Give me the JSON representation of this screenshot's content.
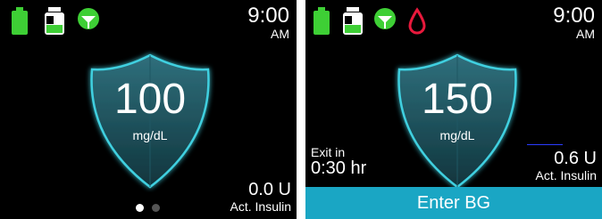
{
  "colors": {
    "battery": "#3ecf35",
    "insulin_cart": "#3ecf35",
    "signal": "#3ecf35",
    "drop_alert": "#e8193c",
    "shield_glow": "#3fd0e0",
    "button": "#1aa6c4"
  },
  "left_screen": {
    "status_icons": [
      "battery-icon",
      "insulin-cartridge-icon",
      "signal-icon"
    ],
    "time": "9:00",
    "ampm": "AM",
    "bg_value": "100",
    "bg_unit": "mg/dL",
    "insulin_value": "0.0 U",
    "insulin_label": "Act. Insulin",
    "page_dots": 2,
    "active_dot": 0
  },
  "right_screen": {
    "status_icons": [
      "battery-icon",
      "insulin-cartridge-icon",
      "signal-icon",
      "blood-drop-icon"
    ],
    "time": "9:00",
    "ampm": "AM",
    "bg_value": "150",
    "bg_unit": "mg/dL",
    "exit_label": "Exit in",
    "exit_value": "0:30 hr",
    "insulin_value": "0.6 U",
    "insulin_label": "Act. Insulin",
    "button_label": "Enter BG"
  }
}
